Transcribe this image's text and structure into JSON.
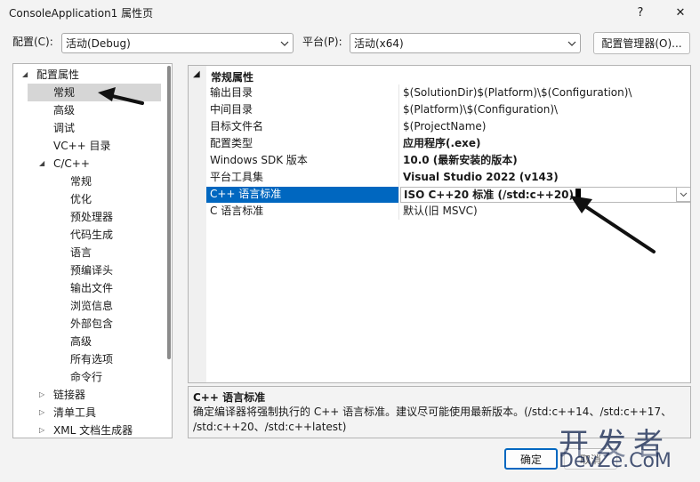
{
  "window": {
    "title": "ConsoleApplication1 属性页",
    "help": "?",
    "close": "✕"
  },
  "config_bar": {
    "config_label": "配置(C):",
    "config_value": "活动(Debug)",
    "platform_label": "平台(P):",
    "platform_value": "活动(x64)",
    "manager_button": "配置管理器(O)..."
  },
  "tree": {
    "items": [
      {
        "label": "配置属性",
        "level": 0,
        "expander": "expanded"
      },
      {
        "label": "常规",
        "level": 1,
        "selected": true
      },
      {
        "label": "高级",
        "level": 1
      },
      {
        "label": "调试",
        "level": 1
      },
      {
        "label": "VC++ 目录",
        "level": 1
      },
      {
        "label": "C/C++",
        "level": 1,
        "expander": "expanded"
      },
      {
        "label": "常规",
        "level": 2
      },
      {
        "label": "优化",
        "level": 2
      },
      {
        "label": "预处理器",
        "level": 2
      },
      {
        "label": "代码生成",
        "level": 2
      },
      {
        "label": "语言",
        "level": 2
      },
      {
        "label": "预编译头",
        "level": 2
      },
      {
        "label": "输出文件",
        "level": 2
      },
      {
        "label": "浏览信息",
        "level": 2
      },
      {
        "label": "外部包含",
        "level": 2
      },
      {
        "label": "高级",
        "level": 2
      },
      {
        "label": "所有选项",
        "level": 2
      },
      {
        "label": "命令行",
        "level": 2
      },
      {
        "label": "链接器",
        "level": 1,
        "expander": "collapsed"
      },
      {
        "label": "清单工具",
        "level": 1,
        "expander": "collapsed"
      },
      {
        "label": "XML 文档生成器",
        "level": 1,
        "expander": "collapsed"
      }
    ]
  },
  "grid": {
    "category": "常规属性",
    "rows": [
      {
        "name": "输出目录",
        "value": "$(SolutionDir)$(Platform)\\$(Configuration)\\",
        "bold": false
      },
      {
        "name": "中间目录",
        "value": "$(Platform)\\$(Configuration)\\",
        "bold": false
      },
      {
        "name": "目标文件名",
        "value": "$(ProjectName)",
        "bold": false
      },
      {
        "name": "配置类型",
        "value": "应用程序(.exe)",
        "bold": true
      },
      {
        "name": "Windows SDK 版本",
        "value": "10.0 (最新安装的版本)",
        "bold": true
      },
      {
        "name": "平台工具集",
        "value": "Visual Studio 2022 (v143)",
        "bold": true
      },
      {
        "name": "C++ 语言标准",
        "value": "ISO C++20 标准 (/std:c++20)",
        "bold": true,
        "selected": true
      },
      {
        "name": "C 语言标准",
        "value": "默认(旧 MSVC)",
        "bold": false
      }
    ]
  },
  "description": {
    "title": "C++ 语言标准",
    "line1": "确定编译器将强制执行的 C++ 语言标准。建议尽可能使用最新版本。(/std:c++14、/std:c++17、",
    "line2": "/std:c++20、/std:c++latest)"
  },
  "buttons": {
    "ok": "确定",
    "cancel": "取消"
  },
  "watermark": {
    "line1": "开发者",
    "line2": "DevZe.CoM"
  },
  "colors": {
    "accent": "#0067c0",
    "selection_gray": "#d6d6d6"
  }
}
